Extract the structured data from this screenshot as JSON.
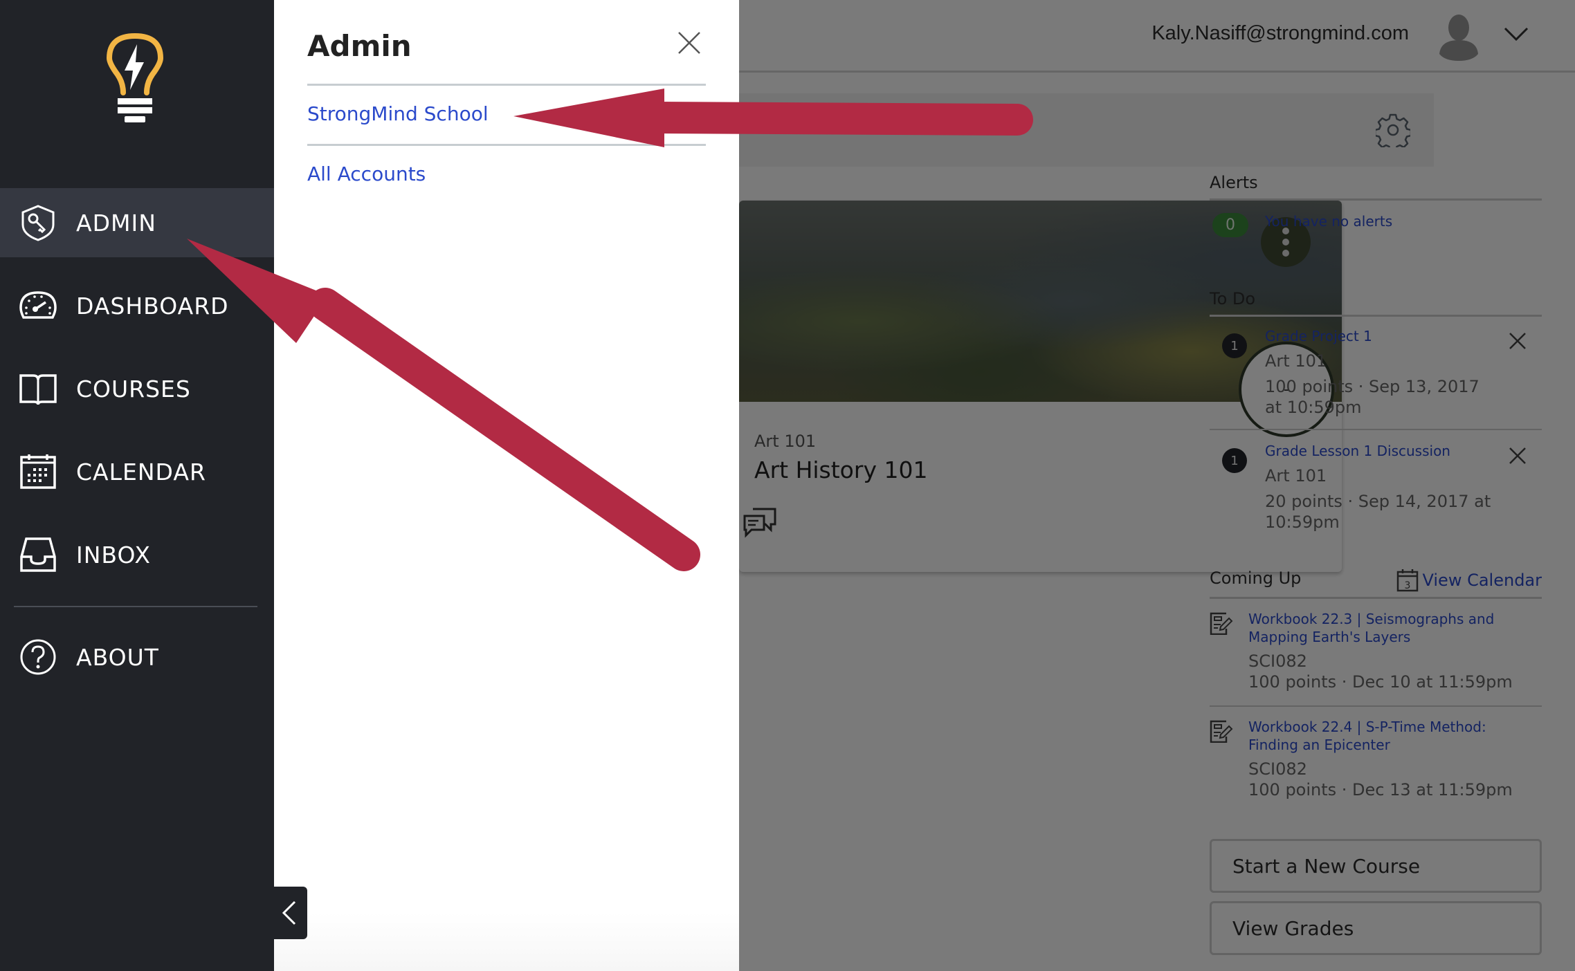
{
  "header": {
    "user_email": "Kaly.Nasiff@strongmind.com",
    "avatar_icon": "avatar-icon",
    "menu_icon": "chevron-down-icon"
  },
  "sidebar": {
    "logo_icon": "lightbulb-logo-icon",
    "items": [
      {
        "label": "ADMIN",
        "icon": "shield-key-icon",
        "active": true
      },
      {
        "label": "DASHBOARD",
        "icon": "speedometer-icon",
        "active": false
      },
      {
        "label": "COURSES",
        "icon": "open-book-icon",
        "active": false
      },
      {
        "label": "CALENDAR",
        "icon": "calendar-icon",
        "active": false
      },
      {
        "label": "INBOX",
        "icon": "inbox-tray-icon",
        "active": false
      },
      {
        "label": "ABOUT",
        "icon": "question-circle-icon",
        "active": false
      }
    ],
    "collapse_icon": "chevron-left-icon"
  },
  "tray": {
    "title": "Admin",
    "close_icon": "close-icon",
    "links": [
      "StrongMind School",
      "All Accounts"
    ]
  },
  "dashboard": {
    "options_icon": "gear-icon",
    "course_card": {
      "code": "Art 101",
      "title": "Art History 101",
      "grade": "-",
      "menu_icon": "kebab-menu-icon",
      "discussion_icon": "discussion-icon"
    }
  },
  "right_column": {
    "alerts": {
      "heading": "Alerts",
      "count": "0",
      "message": "You have no alerts"
    },
    "todo": {
      "heading": "To Do",
      "items": [
        {
          "badge": "1",
          "title": "Grade Project 1",
          "course": "Art 101",
          "meta": "100 points · Sep 13, 2017 at 10:59pm"
        },
        {
          "badge": "1",
          "title": "Grade Lesson 1 Discussion",
          "course": "Art 101",
          "meta": "20 points · Sep 14, 2017 at 10:59pm"
        }
      ]
    },
    "coming_up": {
      "heading": "Coming Up",
      "view_calendar": "View Calendar",
      "calendar_day": "3",
      "items": [
        {
          "title": "Workbook 22.3 | Seismographs and Mapping Earth's Layers",
          "course": "SCI082",
          "meta": "100 points · Dec 10 at 11:59pm"
        },
        {
          "title": "Workbook 22.4 | S-P-Time Method: Finding an Epicenter",
          "course": "SCI082",
          "meta": "100 points · Dec 13 at 11:59pm"
        }
      ]
    },
    "buttons": {
      "start_course": "Start a New Course",
      "view_grades": "View Grades"
    }
  },
  "annotation": {
    "arrow_color": "#b22a44"
  }
}
